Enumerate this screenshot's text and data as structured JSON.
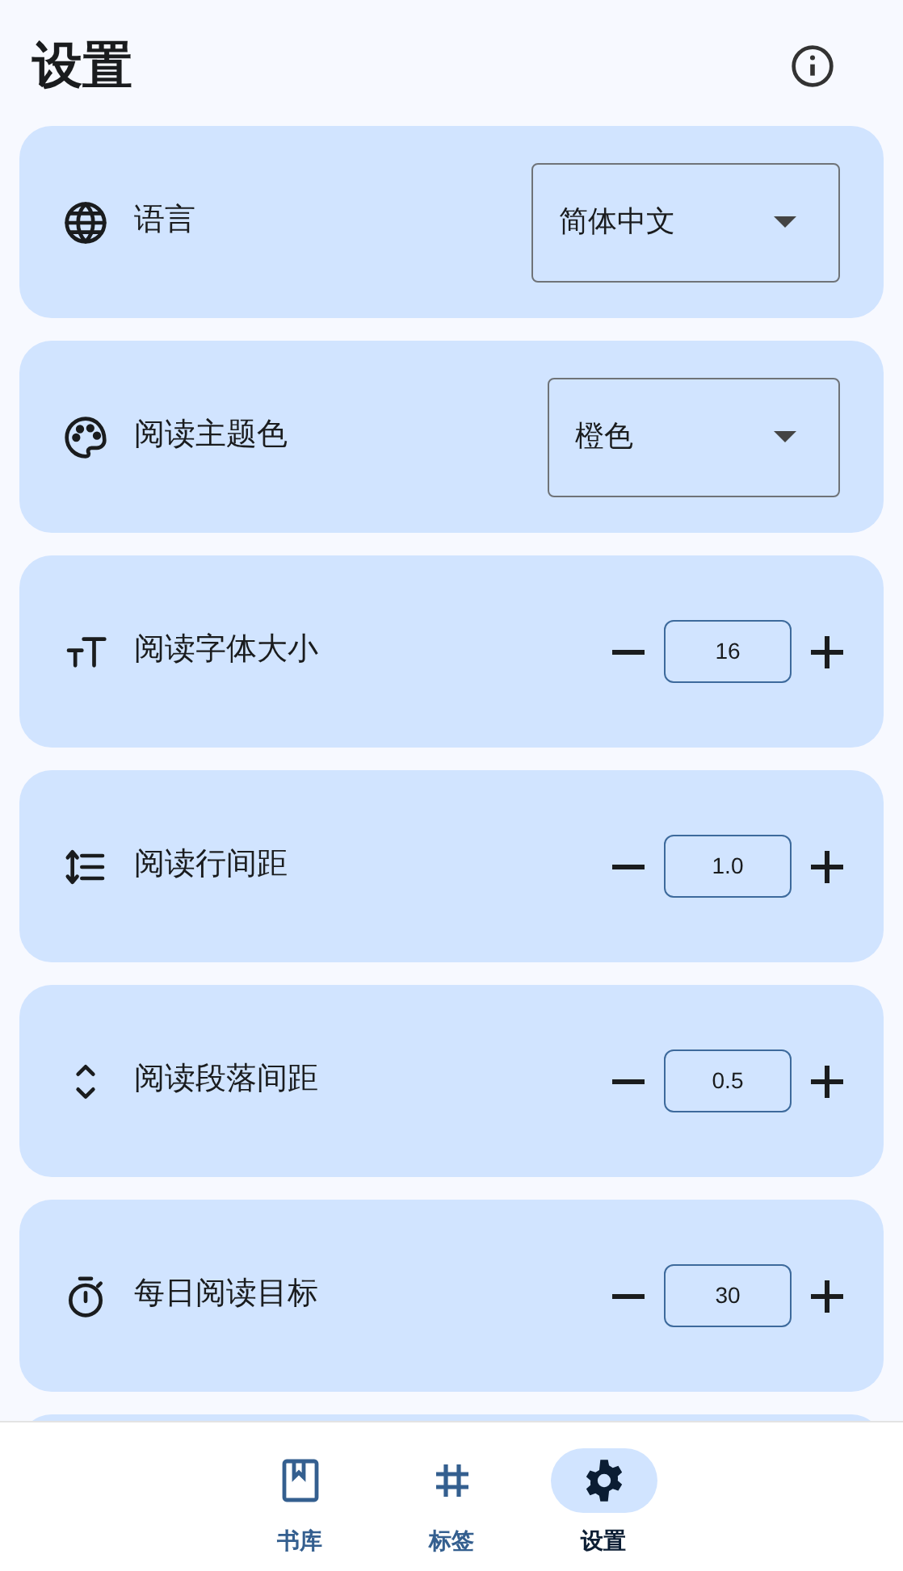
{
  "header": {
    "title": "设置"
  },
  "settings": [
    {
      "kind": "dropdown",
      "label": "语言",
      "value": "简体中文"
    },
    {
      "kind": "dropdown",
      "label": "阅读主题色",
      "value": "橙色"
    },
    {
      "kind": "stepper",
      "label": "阅读字体大小",
      "value": "16"
    },
    {
      "kind": "stepper",
      "label": "阅读行间距",
      "value": "1.0"
    },
    {
      "kind": "stepper",
      "label": "阅读段落间距",
      "value": "0.5"
    },
    {
      "kind": "stepper",
      "label": "每日阅读目标",
      "value": "30"
    },
    {
      "kind": "cut_off"
    }
  ],
  "bottom_nav": [
    {
      "label": "书库",
      "selected": false
    },
    {
      "label": "标签",
      "selected": false
    },
    {
      "label": "设置",
      "selected": true
    }
  ]
}
